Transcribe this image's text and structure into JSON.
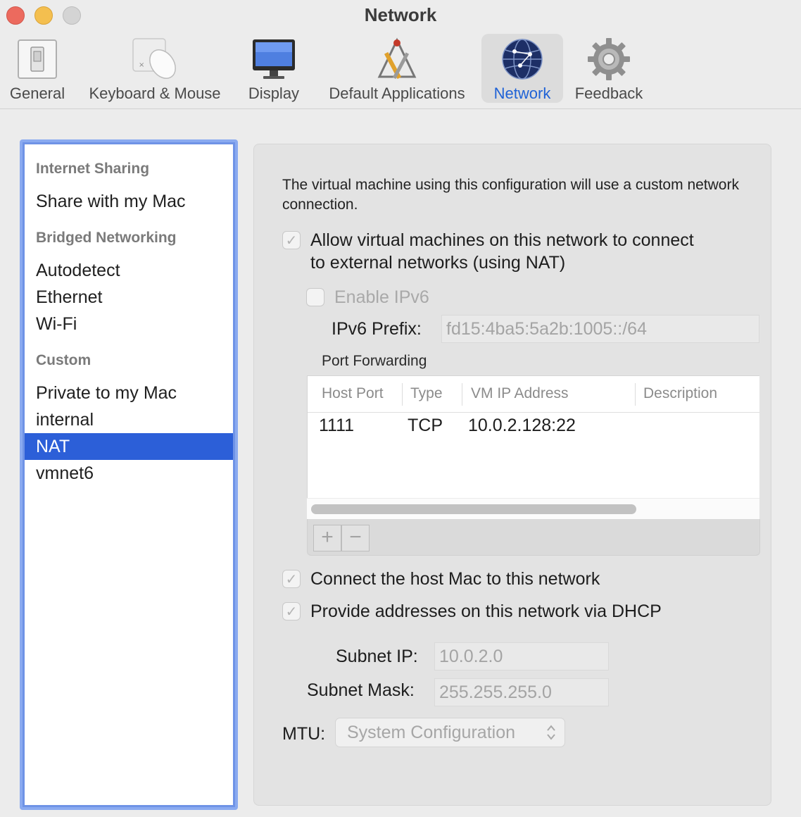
{
  "window": {
    "title": "Network"
  },
  "toolbar": {
    "items": [
      {
        "label": "General",
        "icon": "switch-icon"
      },
      {
        "label": "Keyboard & Mouse",
        "icon": "mouse-icon"
      },
      {
        "label": "Display",
        "icon": "monitor-icon"
      },
      {
        "label": "Default Applications",
        "icon": "app-tools-icon"
      },
      {
        "label": "Network",
        "icon": "globe-network-icon",
        "active": true
      },
      {
        "label": "Feedback",
        "icon": "gear-icon"
      }
    ]
  },
  "sidebar": {
    "sections": [
      {
        "header": "Internet Sharing",
        "items": [
          "Share with my Mac"
        ]
      },
      {
        "header": "Bridged Networking",
        "items": [
          "Autodetect",
          "Ethernet",
          "Wi-Fi"
        ]
      },
      {
        "header": "Custom",
        "items": [
          "Private to my Mac",
          "internal",
          "NAT",
          "vmnet6"
        ]
      }
    ],
    "selected": "NAT"
  },
  "main": {
    "description": "The virtual machine using this configuration will use a custom network connection.",
    "allow_nat": {
      "label_line1": "Allow virtual machines on this network to connect",
      "label_line2": "to external networks (using NAT)",
      "checked": true
    },
    "enable_ipv6": {
      "label": "Enable IPv6",
      "checked": false
    },
    "ipv6_prefix": {
      "label": "IPv6 Prefix:",
      "value": "fd15:4ba5:5a2b:1005::/64"
    },
    "port_forwarding": {
      "title": "Port Forwarding",
      "columns": [
        "Host Port",
        "Type",
        "VM IP Address",
        "Description"
      ],
      "rows": [
        {
          "host_port": "1111",
          "type": "TCP",
          "vm_ip": "10.0.2.128:22",
          "description": ""
        }
      ],
      "add_label": "+",
      "remove_label": "−"
    },
    "connect_host": {
      "label": "Connect the host Mac to this network",
      "checked": true
    },
    "dhcp": {
      "label": "Provide addresses on this network via DHCP",
      "checked": true
    },
    "subnet_ip": {
      "label": "Subnet IP:",
      "value": "10.0.2.0"
    },
    "subnet_mask": {
      "label": "Subnet Mask:",
      "value": "255.255.255.0"
    },
    "mtu": {
      "label": "MTU:",
      "value": "System Configuration"
    }
  },
  "colors": {
    "accent": "#2c5fd8",
    "active_label": "#1f62d6",
    "close": "#ec6a5e",
    "minimize": "#f4bf4f"
  }
}
